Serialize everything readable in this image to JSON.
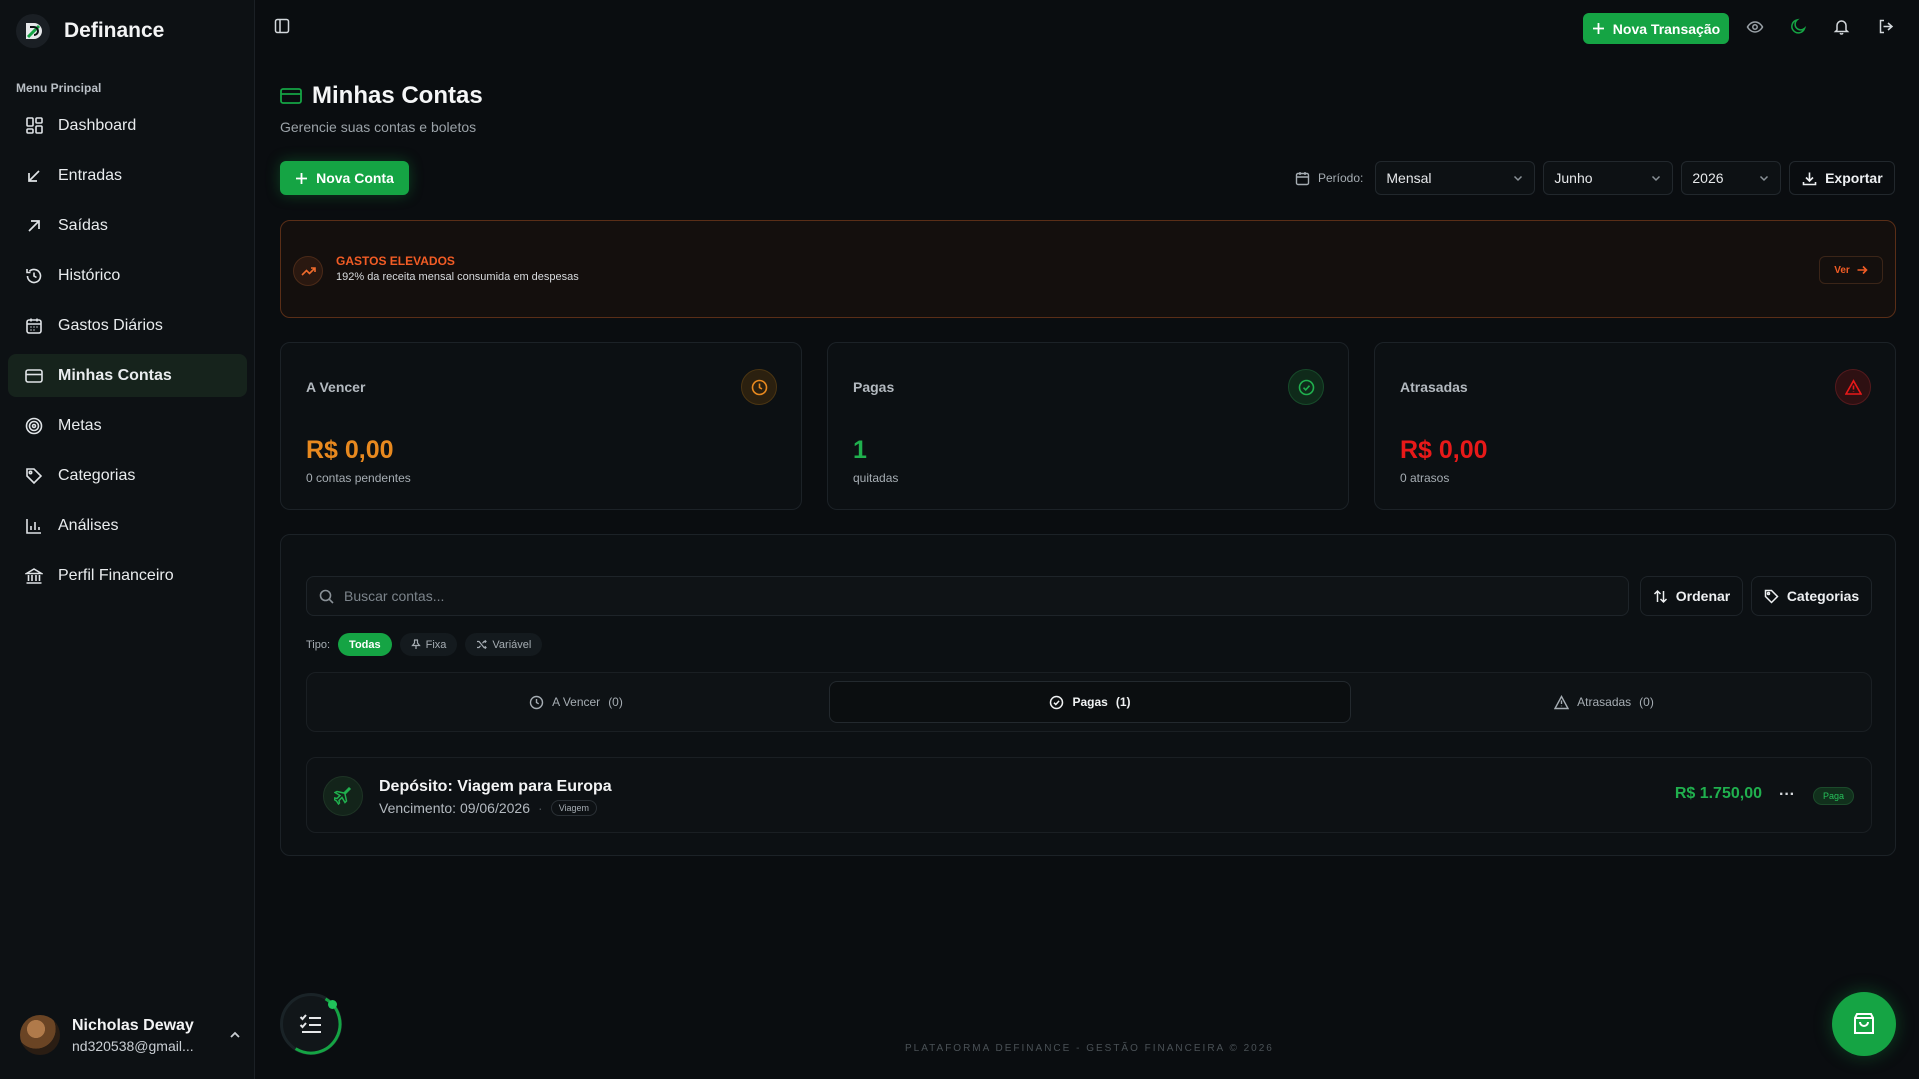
{
  "app": {
    "name": "Definance"
  },
  "sidebar": {
    "menu_title": "Menu Principal",
    "items": [
      {
        "label": "Dashboard",
        "icon": "dashboard-icon"
      },
      {
        "label": "Entradas",
        "icon": "arrow-down-left-icon"
      },
      {
        "label": "Saídas",
        "icon": "arrow-up-right-icon"
      },
      {
        "label": "Histórico",
        "icon": "history-icon"
      },
      {
        "label": "Gastos Diários",
        "icon": "calendar-icon"
      },
      {
        "label": "Minhas Contas",
        "icon": "credit-card-icon",
        "active": true
      },
      {
        "label": "Metas",
        "icon": "target-icon"
      },
      {
        "label": "Categorias",
        "icon": "tag-icon"
      },
      {
        "label": "Análises",
        "icon": "bar-chart-icon"
      },
      {
        "label": "Perfil Financeiro",
        "icon": "bank-icon"
      }
    ],
    "user": {
      "name": "Nicholas Deway",
      "email": "nd320538@gmail..."
    }
  },
  "topbar": {
    "new_transaction": "Nova Transação"
  },
  "page": {
    "title": "Minhas Contas",
    "subtitle": "Gerencie suas contas e boletos",
    "new_account": "Nova Conta",
    "period_label": "Período:",
    "period_mode": "Mensal",
    "month": "Junho",
    "year": "2026",
    "export": "Exportar"
  },
  "alert": {
    "title": "GASTOS ELEVADOS",
    "text": "192% da receita mensal consumida em despesas",
    "button": "Ver"
  },
  "cards": [
    {
      "label": "A Vencer",
      "value": "R$ 0,00",
      "sub": "0 contas pendentes",
      "color": "#e8891f"
    },
    {
      "label": "Pagas",
      "value": "1",
      "sub": "quitadas",
      "color": "#20b04e"
    },
    {
      "label": "Atrasadas",
      "value": "R$ 0,00",
      "sub": "0 atrasos",
      "color": "#e81919"
    }
  ],
  "list": {
    "search_placeholder": "Buscar contas...",
    "sort": "Ordenar",
    "categories": "Categorias",
    "type_label": "Tipo:",
    "type_chips": [
      "Todas",
      "Fixa",
      "Variável"
    ],
    "tabs": [
      {
        "label": "A Vencer",
        "count": "(0)"
      },
      {
        "label": "Pagas",
        "count": "(1)"
      },
      {
        "label": "Atrasadas",
        "count": "(0)"
      }
    ],
    "items": [
      {
        "title": "Depósito: Viagem para Europa",
        "due": "Vencimento: 09/06/2026",
        "tag": "Viagem",
        "amount": "R$ 1.750,00",
        "status": "Paga",
        "more": "···"
      }
    ]
  },
  "footer": "PLATAFORMA DEFINANCE - GESTÃO FINANCEIRA © 2026",
  "colors": {
    "accent": "#15a444",
    "warning": "#f25c25",
    "danger": "#e81919",
    "pending": "#e8891f"
  }
}
